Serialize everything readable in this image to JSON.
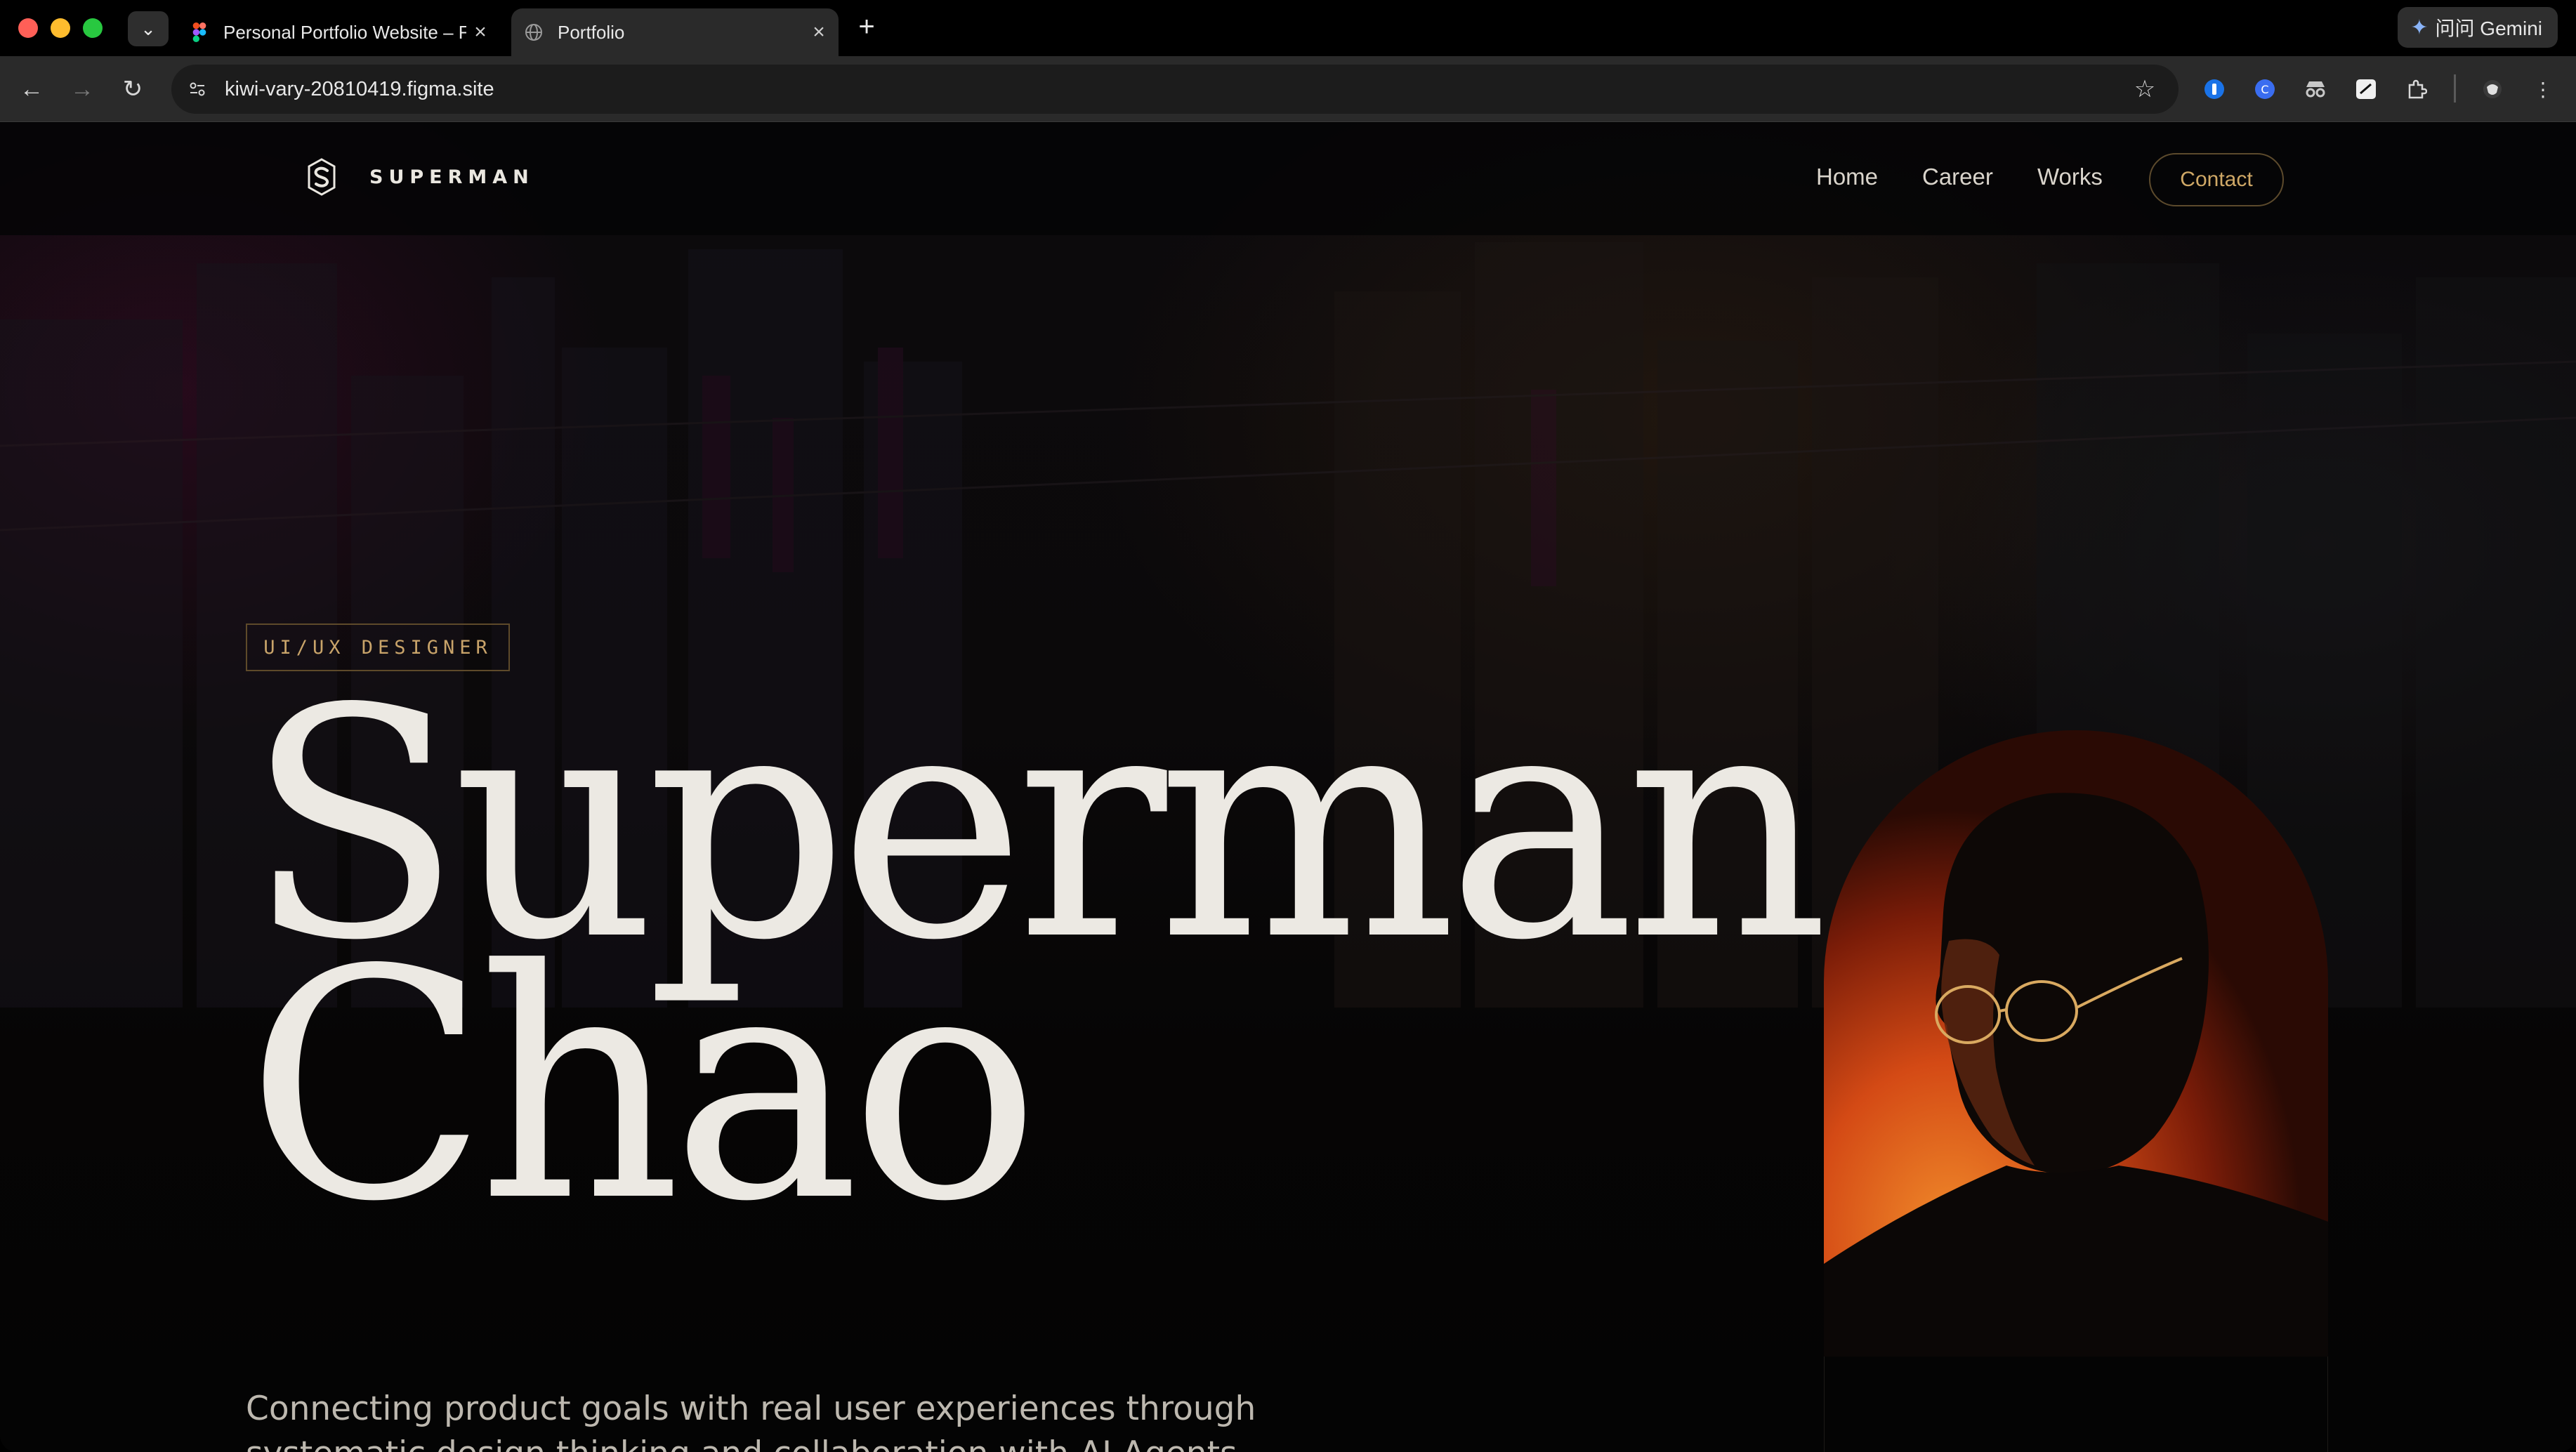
{
  "browser": {
    "tabs": [
      {
        "title": "Personal Portfolio Website – F",
        "favicon": "figma-icon"
      },
      {
        "title": "Portfolio",
        "favicon": "globe-icon",
        "active": true
      }
    ],
    "url": "kiwi-vary-20810419.figma.site",
    "gemini_label": "问问 Gemini"
  },
  "site": {
    "logo_text": "SUPERMAN",
    "nav": {
      "home": "Home",
      "career": "Career",
      "works": "Works",
      "contact": "Contact"
    },
    "hero": {
      "role": "UI/UX DESIGNER",
      "name_line1": "Superman",
      "name_line2": "Chao",
      "tagline_line1": "Connecting product goals with real user experiences through",
      "tagline_line2": "systematic design thinking and collaboration with AI Agents."
    }
  },
  "colors": {
    "accent_gold": "#c9a46a",
    "hero_text": "#ece9e3",
    "portrait_orange": "#f08a2a"
  }
}
